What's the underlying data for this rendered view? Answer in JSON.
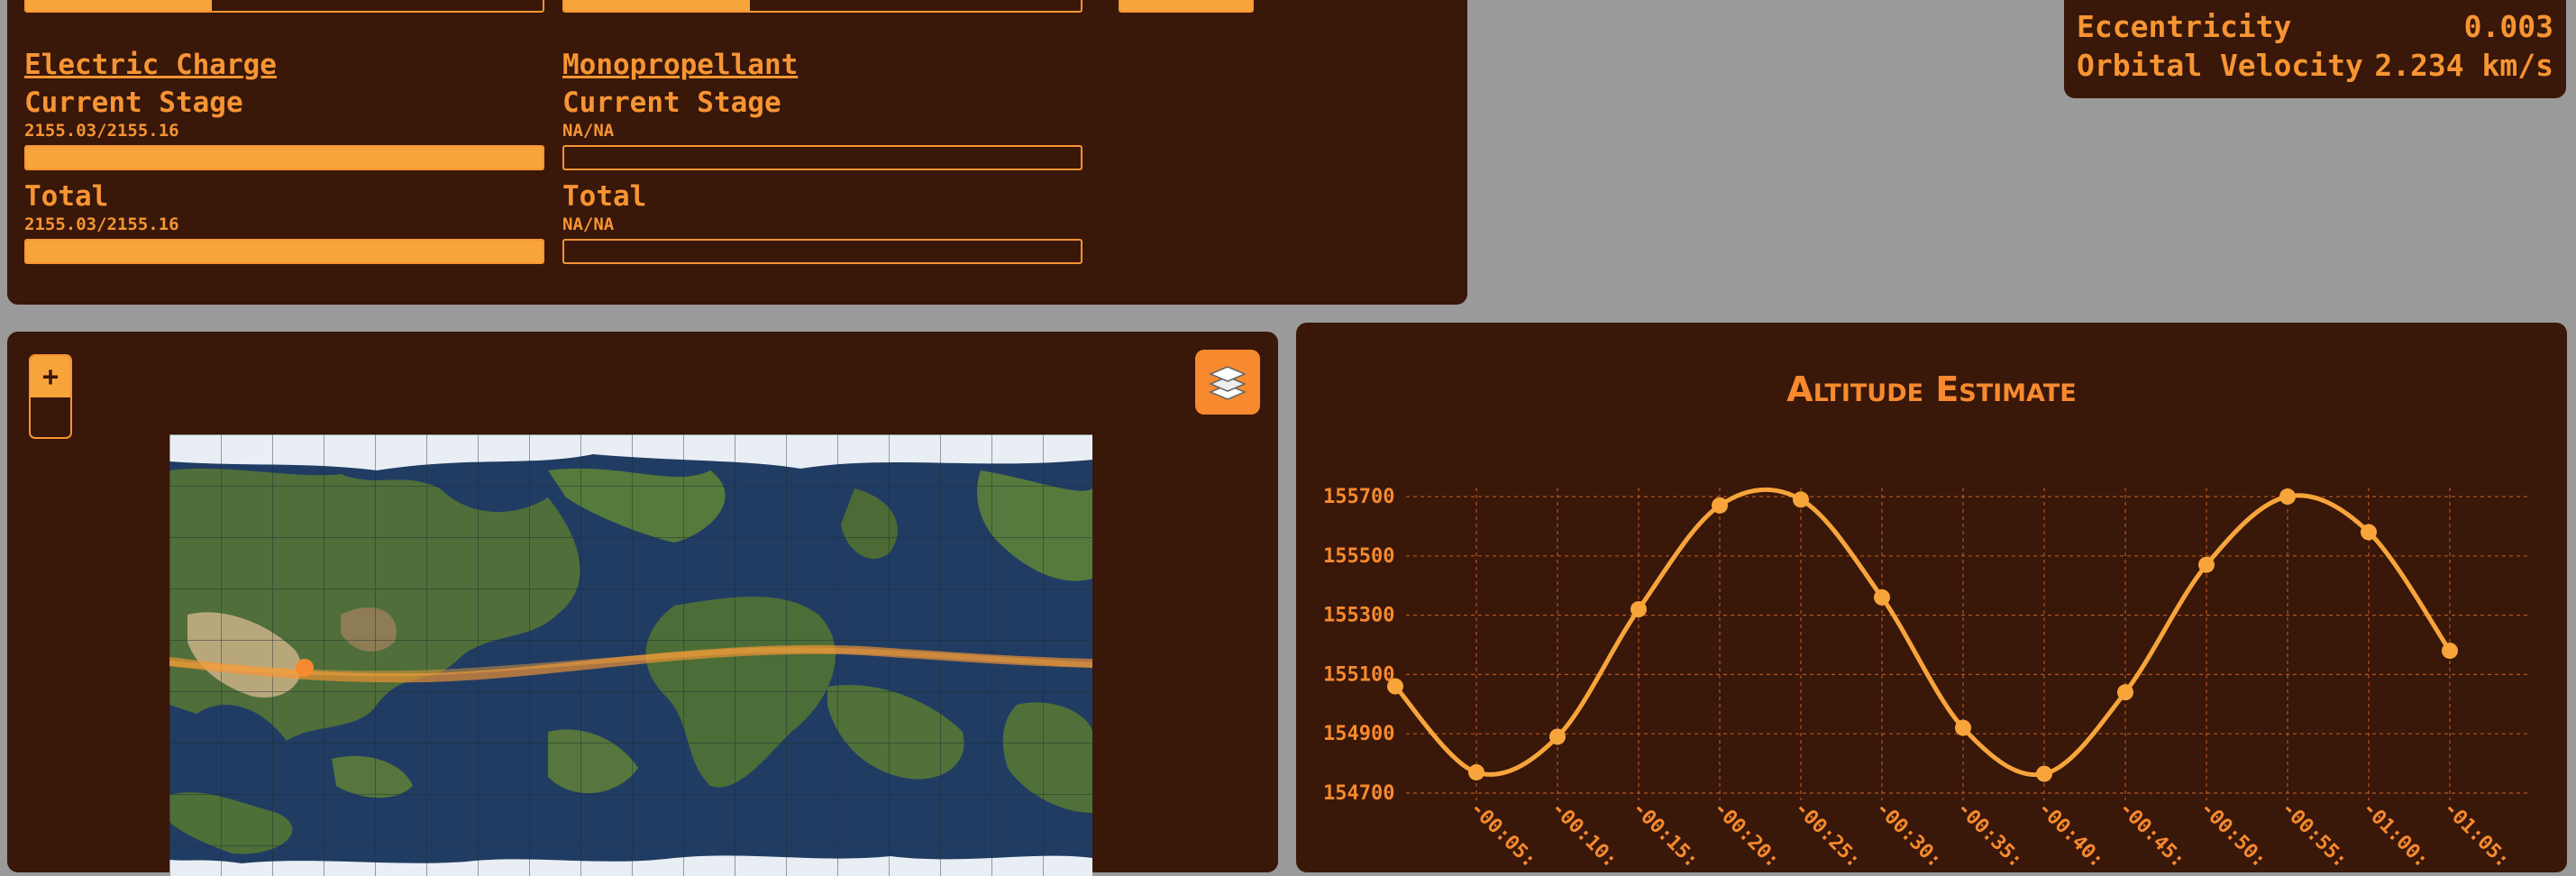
{
  "resources": {
    "top_row_fills": [
      0.36,
      0.36,
      1.0
    ],
    "items": [
      {
        "name": "Electric Charge",
        "stage_label": "Current Stage",
        "stage_value": "2155.03/2155.16",
        "stage_fraction": 0.9999,
        "total_label": "Total",
        "total_value": "2155.03/2155.16",
        "total_fraction": 0.9999
      },
      {
        "name": "Monopropellant",
        "stage_label": "Current Stage",
        "stage_value": "NA/NA",
        "stage_fraction": 0,
        "total_label": "Total",
        "total_value": "NA/NA",
        "total_fraction": 0
      }
    ]
  },
  "orbit": {
    "eccentricity_label": "Eccentricity",
    "eccentricity_value": "0.003",
    "velocity_label": "Orbital Velocity",
    "velocity_value": "2.234 km/s"
  },
  "map": {
    "zoom_in_label": "+",
    "layers_icon": "layers-icon"
  },
  "colors": {
    "background": "#9a9a9a",
    "panel": "#391709",
    "accent": "#f79533",
    "accent_bright": "#f7a53b",
    "button": "#f78a2e"
  },
  "chart_data": {
    "type": "line",
    "title": "Altitude Estimate",
    "xlabel": "",
    "ylabel": "",
    "grid": true,
    "y_ticks": [
      "154700",
      "154900",
      "155100",
      "155300",
      "155500",
      "155700"
    ],
    "x_ticks": [
      "-00:05:",
      "-00:10:",
      "-00:15:",
      "-00:20:",
      "-00:25:",
      "-00:30:",
      "-00:35:",
      "-00:40:",
      "-00:45:",
      "-00:50:",
      "-00:55:",
      "-01:00:",
      "-01:05:"
    ],
    "ylim": [
      154700,
      155700
    ],
    "series": [
      {
        "values": [
          155060,
          154770,
          154890,
          155320,
          155670,
          155690,
          155360,
          154920,
          154765,
          155040,
          155470,
          155700,
          155580,
          155180
        ]
      }
    ]
  }
}
